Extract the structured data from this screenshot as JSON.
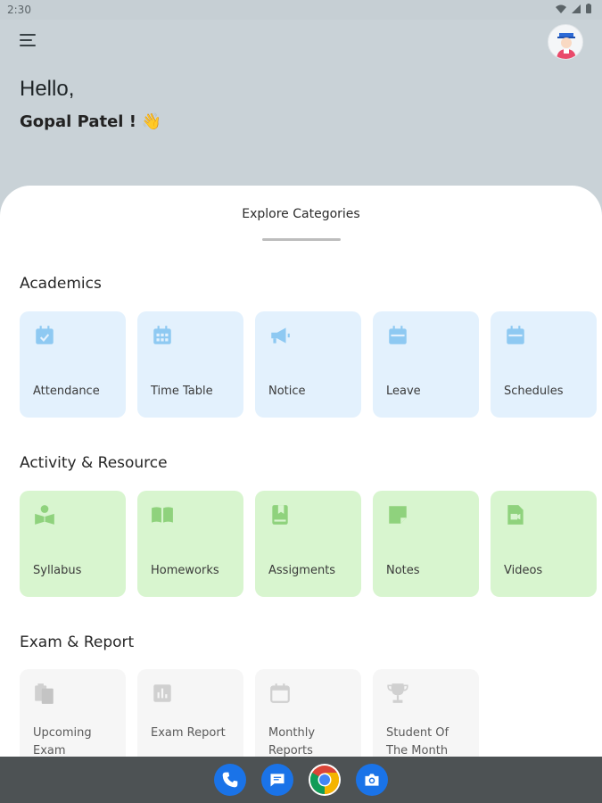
{
  "status_bar": {
    "time": "2:30"
  },
  "header": {
    "greeting": "Hello,",
    "user_name": "Gopal Patel !",
    "wave_emoji": "👋"
  },
  "sheet": {
    "title": "Explore Categories"
  },
  "sections": [
    {
      "title": "Academics",
      "color": "#e3f1fd",
      "icon_color": "#8ec9f2",
      "items": [
        {
          "label": "Attendance",
          "icon": "calendar-check-icon"
        },
        {
          "label": "Time Table",
          "icon": "calendar-grid-icon"
        },
        {
          "label": "Notice",
          "icon": "megaphone-icon"
        },
        {
          "label": "Leave",
          "icon": "calendar-icon"
        },
        {
          "label": "Schedules",
          "icon": "calendar-icon"
        }
      ]
    },
    {
      "title": "Activity & Resource",
      "color": "#d8f5cf",
      "icon_color": "#8fd27d",
      "items": [
        {
          "label": "Syllabus",
          "icon": "reader-icon"
        },
        {
          "label": "Homeworks",
          "icon": "book-open-icon"
        },
        {
          "label": "Assigments",
          "icon": "book-bookmark-icon"
        },
        {
          "label": "Notes",
          "icon": "note-icon"
        },
        {
          "label": "Videos",
          "icon": "video-file-icon"
        }
      ]
    },
    {
      "title": "Exam & Report",
      "color": "#f6f6f6",
      "icon_color": "#d0d0d0",
      "items": [
        {
          "label": "Upcoming Exam",
          "icon": "clipboards-icon"
        },
        {
          "label": "Exam Report",
          "icon": "bar-chart-icon"
        },
        {
          "label": "Monthly Reports",
          "icon": "calendar-icon"
        },
        {
          "label": "Student Of The Month",
          "icon": "trophy-icon"
        }
      ]
    }
  ],
  "dock": [
    {
      "app": "Phone",
      "icon": "phone-icon",
      "color": "#1a73e8"
    },
    {
      "app": "Messages",
      "icon": "messages-icon",
      "color": "#1a73e8"
    },
    {
      "app": "Chrome",
      "icon": "chrome-icon",
      "color": "#ffffff"
    },
    {
      "app": "Camera",
      "icon": "camera-icon",
      "color": "#1a73e8"
    }
  ]
}
